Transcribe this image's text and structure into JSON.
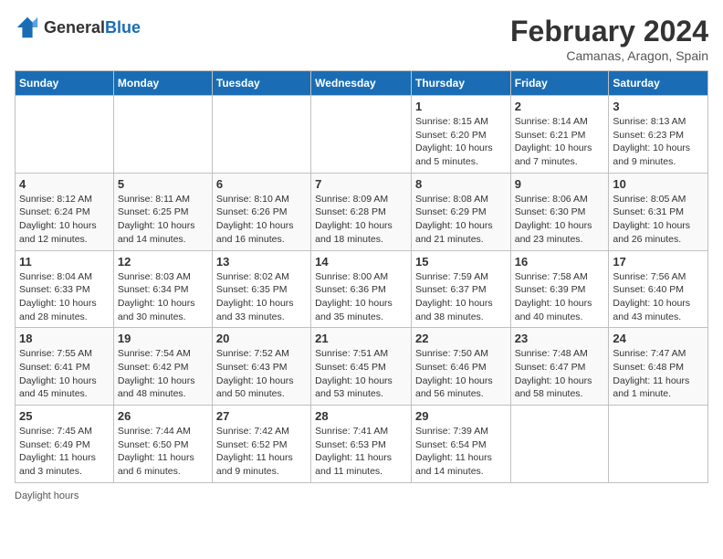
{
  "header": {
    "logo_general": "General",
    "logo_blue": "Blue",
    "main_title": "February 2024",
    "subtitle": "Camanas, Aragon, Spain"
  },
  "days_of_week": [
    "Sunday",
    "Monday",
    "Tuesday",
    "Wednesday",
    "Thursday",
    "Friday",
    "Saturday"
  ],
  "weeks": [
    [
      {
        "day": "",
        "info": ""
      },
      {
        "day": "",
        "info": ""
      },
      {
        "day": "",
        "info": ""
      },
      {
        "day": "",
        "info": ""
      },
      {
        "day": "1",
        "info": "Sunrise: 8:15 AM\nSunset: 6:20 PM\nDaylight: 10 hours and 5 minutes."
      },
      {
        "day": "2",
        "info": "Sunrise: 8:14 AM\nSunset: 6:21 PM\nDaylight: 10 hours and 7 minutes."
      },
      {
        "day": "3",
        "info": "Sunrise: 8:13 AM\nSunset: 6:23 PM\nDaylight: 10 hours and 9 minutes."
      }
    ],
    [
      {
        "day": "4",
        "info": "Sunrise: 8:12 AM\nSunset: 6:24 PM\nDaylight: 10 hours and 12 minutes."
      },
      {
        "day": "5",
        "info": "Sunrise: 8:11 AM\nSunset: 6:25 PM\nDaylight: 10 hours and 14 minutes."
      },
      {
        "day": "6",
        "info": "Sunrise: 8:10 AM\nSunset: 6:26 PM\nDaylight: 10 hours and 16 minutes."
      },
      {
        "day": "7",
        "info": "Sunrise: 8:09 AM\nSunset: 6:28 PM\nDaylight: 10 hours and 18 minutes."
      },
      {
        "day": "8",
        "info": "Sunrise: 8:08 AM\nSunset: 6:29 PM\nDaylight: 10 hours and 21 minutes."
      },
      {
        "day": "9",
        "info": "Sunrise: 8:06 AM\nSunset: 6:30 PM\nDaylight: 10 hours and 23 minutes."
      },
      {
        "day": "10",
        "info": "Sunrise: 8:05 AM\nSunset: 6:31 PM\nDaylight: 10 hours and 26 minutes."
      }
    ],
    [
      {
        "day": "11",
        "info": "Sunrise: 8:04 AM\nSunset: 6:33 PM\nDaylight: 10 hours and 28 minutes."
      },
      {
        "day": "12",
        "info": "Sunrise: 8:03 AM\nSunset: 6:34 PM\nDaylight: 10 hours and 30 minutes."
      },
      {
        "day": "13",
        "info": "Sunrise: 8:02 AM\nSunset: 6:35 PM\nDaylight: 10 hours and 33 minutes."
      },
      {
        "day": "14",
        "info": "Sunrise: 8:00 AM\nSunset: 6:36 PM\nDaylight: 10 hours and 35 minutes."
      },
      {
        "day": "15",
        "info": "Sunrise: 7:59 AM\nSunset: 6:37 PM\nDaylight: 10 hours and 38 minutes."
      },
      {
        "day": "16",
        "info": "Sunrise: 7:58 AM\nSunset: 6:39 PM\nDaylight: 10 hours and 40 minutes."
      },
      {
        "day": "17",
        "info": "Sunrise: 7:56 AM\nSunset: 6:40 PM\nDaylight: 10 hours and 43 minutes."
      }
    ],
    [
      {
        "day": "18",
        "info": "Sunrise: 7:55 AM\nSunset: 6:41 PM\nDaylight: 10 hours and 45 minutes."
      },
      {
        "day": "19",
        "info": "Sunrise: 7:54 AM\nSunset: 6:42 PM\nDaylight: 10 hours and 48 minutes."
      },
      {
        "day": "20",
        "info": "Sunrise: 7:52 AM\nSunset: 6:43 PM\nDaylight: 10 hours and 50 minutes."
      },
      {
        "day": "21",
        "info": "Sunrise: 7:51 AM\nSunset: 6:45 PM\nDaylight: 10 hours and 53 minutes."
      },
      {
        "day": "22",
        "info": "Sunrise: 7:50 AM\nSunset: 6:46 PM\nDaylight: 10 hours and 56 minutes."
      },
      {
        "day": "23",
        "info": "Sunrise: 7:48 AM\nSunset: 6:47 PM\nDaylight: 10 hours and 58 minutes."
      },
      {
        "day": "24",
        "info": "Sunrise: 7:47 AM\nSunset: 6:48 PM\nDaylight: 11 hours and 1 minute."
      }
    ],
    [
      {
        "day": "25",
        "info": "Sunrise: 7:45 AM\nSunset: 6:49 PM\nDaylight: 11 hours and 3 minutes."
      },
      {
        "day": "26",
        "info": "Sunrise: 7:44 AM\nSunset: 6:50 PM\nDaylight: 11 hours and 6 minutes."
      },
      {
        "day": "27",
        "info": "Sunrise: 7:42 AM\nSunset: 6:52 PM\nDaylight: 11 hours and 9 minutes."
      },
      {
        "day": "28",
        "info": "Sunrise: 7:41 AM\nSunset: 6:53 PM\nDaylight: 11 hours and 11 minutes."
      },
      {
        "day": "29",
        "info": "Sunrise: 7:39 AM\nSunset: 6:54 PM\nDaylight: 11 hours and 14 minutes."
      },
      {
        "day": "",
        "info": ""
      },
      {
        "day": "",
        "info": ""
      }
    ]
  ],
  "footer": {
    "label": "Daylight hours"
  }
}
